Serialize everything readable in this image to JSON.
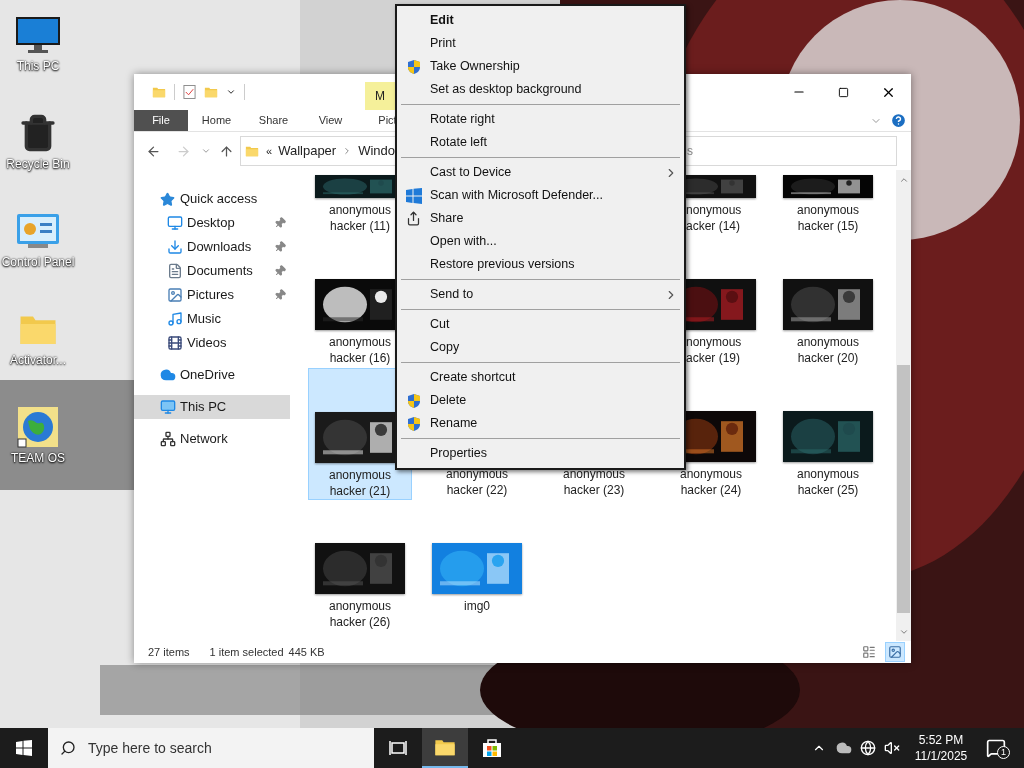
{
  "desktop_icons": [
    {
      "label": "This PC"
    },
    {
      "label": "Recycle Bin"
    },
    {
      "label": "Control Panel"
    },
    {
      "label": "Activator..."
    },
    {
      "label": "TEAM OS"
    }
  ],
  "explorer": {
    "contextual_tab": "M",
    "ribbon_tabs": [
      {
        "label": "File",
        "selected": true
      },
      {
        "label": "Home",
        "selected": false
      },
      {
        "label": "Share",
        "selected": false
      },
      {
        "label": "View",
        "selected": false
      },
      {
        "label": "Pict",
        "selected": false
      }
    ],
    "breadcrumb": {
      "overflow": "«",
      "parts": [
        "Wallpaper",
        "Windo"
      ]
    },
    "search": {
      "placeholder": "s"
    },
    "nav": [
      {
        "label": "Quick access",
        "selected": false,
        "children": [
          {
            "label": "Desktop",
            "pinned": true,
            "selected": false
          },
          {
            "label": "Downloads",
            "pinned": true,
            "selected": false
          },
          {
            "label": "Documents",
            "pinned": true,
            "selected": false
          },
          {
            "label": "Pictures",
            "pinned": true,
            "selected": false
          },
          {
            "label": "Music",
            "pinned": false,
            "selected": false
          },
          {
            "label": "Videos",
            "pinned": false,
            "selected": false
          }
        ]
      },
      {
        "label": "OneDrive",
        "selected": false
      },
      {
        "label": "This PC",
        "selected": true
      },
      {
        "label": "Network",
        "selected": false
      }
    ],
    "rows": [
      {
        "items": [
          {
            "label": "anonymous hacker (11)",
            "kind": "tile",
            "selected": false
          },
          {
            "label": "nonymous acker (14)",
            "kind": "partial",
            "selected": false
          },
          {
            "label": "anonymous hacker (15)",
            "kind": "tile",
            "selected": false
          }
        ]
      },
      {
        "items": [
          {
            "label": "anonymous hacker (16)",
            "kind": "tile",
            "selected": false
          },
          {
            "label": "nonymous acker (19)",
            "kind": "partial",
            "selected": false
          },
          {
            "label": "anonymous hacker (20)",
            "kind": "tile",
            "selected": false
          }
        ]
      },
      {
        "items": [
          {
            "label": "anonymous hacker (21)",
            "kind": "tile",
            "selected": true
          },
          {
            "label": "anonymous hacker (22)",
            "kind": "label_only",
            "selected": false
          },
          {
            "label": "anonymous hacker (23)",
            "kind": "label_only",
            "selected": false
          },
          {
            "label": "anonymous hacker (24)",
            "kind": "tile",
            "selected": false
          },
          {
            "label": "anonymous hacker (25)",
            "kind": "tile",
            "selected": false
          }
        ]
      },
      {
        "items": [
          {
            "label": "anonymous hacker (26)",
            "kind": "tile",
            "selected": false
          },
          {
            "label": "img0",
            "kind": "tile",
            "selected": false
          }
        ]
      }
    ],
    "status": {
      "count": "27 items",
      "selection": "1 item selected",
      "size": "445 KB"
    },
    "views": [
      {
        "kind": "details",
        "selected": false
      },
      {
        "kind": "thumbnails",
        "selected": true
      }
    ]
  },
  "context_menu": [
    [
      {
        "label": "Edit",
        "kind": "plain",
        "default": true,
        "submenu": false
      },
      {
        "label": "Print",
        "kind": "plain",
        "default": false,
        "submenu": false
      },
      {
        "label": "Take Ownership",
        "kind": "admin",
        "default": false,
        "submenu": false
      },
      {
        "label": "Set as desktop background",
        "kind": "plain",
        "default": false,
        "submenu": false
      }
    ],
    [
      {
        "label": "Rotate right",
        "kind": "plain",
        "default": false,
        "submenu": false
      },
      {
        "label": "Rotate left",
        "kind": "plain",
        "default": false,
        "submenu": false
      }
    ],
    [
      {
        "label": "Cast to Device",
        "kind": "plain",
        "default": false,
        "submenu": true
      },
      {
        "label": "Scan with Microsoft Defender...",
        "kind": "scan",
        "default": false,
        "submenu": false
      },
      {
        "label": "Share",
        "kind": "share",
        "default": false,
        "submenu": false
      },
      {
        "label": "Open with...",
        "kind": "plain",
        "default": false,
        "submenu": false
      },
      {
        "label": "Restore previous versions",
        "kind": "plain",
        "default": false,
        "submenu": false
      }
    ],
    [
      {
        "label": "Send to",
        "kind": "plain",
        "default": false,
        "submenu": true
      }
    ],
    [
      {
        "label": "Cut",
        "kind": "plain",
        "default": false,
        "submenu": false
      },
      {
        "label": "Copy",
        "kind": "plain",
        "default": false,
        "submenu": false
      }
    ],
    [
      {
        "label": "Create shortcut",
        "kind": "plain",
        "default": false,
        "submenu": false
      },
      {
        "label": "Delete",
        "kind": "admin",
        "default": false,
        "submenu": false
      },
      {
        "label": "Rename",
        "kind": "admin",
        "default": false,
        "submenu": false
      }
    ],
    [
      {
        "label": "Properties",
        "kind": "plain",
        "default": false,
        "submenu": false
      }
    ]
  ],
  "taskbar": {
    "search_placeholder": "Type here to search",
    "apps": [
      {
        "kind": "taskview",
        "active": false
      },
      {
        "kind": "explorer",
        "active": true
      },
      {
        "kind": "store",
        "active": false
      }
    ],
    "time": "5:52 PM",
    "date": "11/1/2025",
    "notification_count": "1"
  }
}
